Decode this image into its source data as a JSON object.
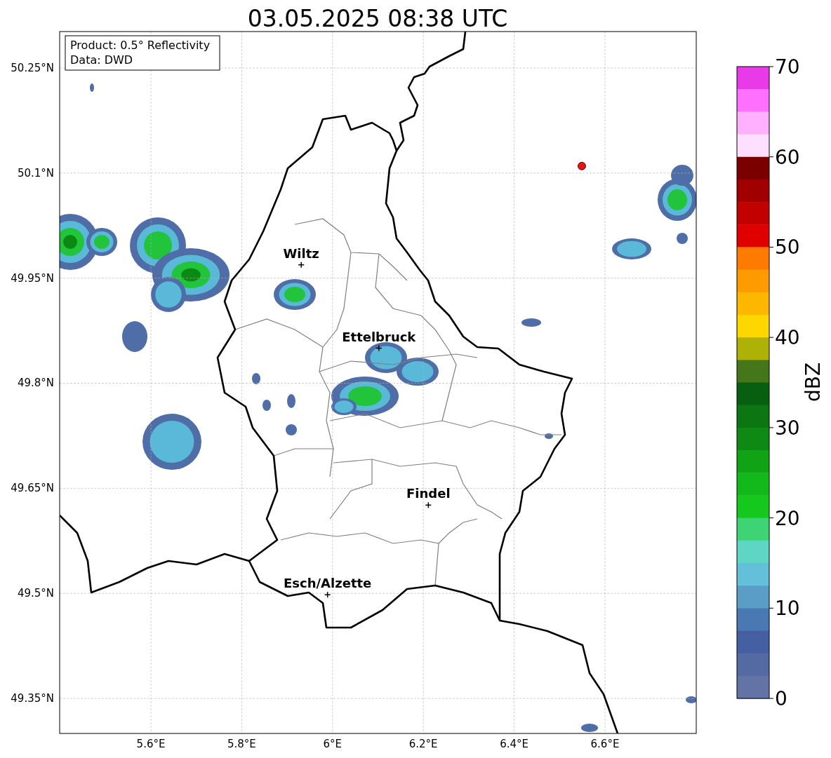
{
  "title": "03.05.2025 08:38 UTC",
  "info_box": [
    "Product: 0.5° Reflectivity",
    "Data: DWD"
  ],
  "map": {
    "x_ticks": [
      "5.6°E",
      "5.8°E",
      "6°E",
      "6.2°E",
      "6.4°E",
      "6.6°E"
    ],
    "y_ticks": [
      "50.25°N",
      "50.1°N",
      "49.95°N",
      "49.8°N",
      "49.65°N",
      "49.5°N",
      "49.35°N"
    ],
    "cities": [
      {
        "name": "Wiltz"
      },
      {
        "name": "Ettelbruck"
      },
      {
        "name": "Findel"
      },
      {
        "name": "Esch/Alzette"
      }
    ],
    "markers": [
      {
        "color": "#ee1111"
      }
    ]
  },
  "colorbar": {
    "label": "dBZ",
    "ticks": [
      "70",
      "60",
      "50",
      "40",
      "30",
      "20",
      "10",
      "0"
    ],
    "segments": [
      {
        "color": "#e83ae8"
      },
      {
        "color": "#ff70ff"
      },
      {
        "color": "#ffb0ff"
      },
      {
        "color": "#ffdfff"
      },
      {
        "color": "#7a0000"
      },
      {
        "color": "#a00000"
      },
      {
        "color": "#c20000"
      },
      {
        "color": "#e00000"
      },
      {
        "color": "#fd7c00"
      },
      {
        "color": "#fd9b00"
      },
      {
        "color": "#fdb700"
      },
      {
        "color": "#fed700"
      },
      {
        "color": "#afb206"
      },
      {
        "color": "#45761a"
      },
      {
        "color": "#085f10"
      },
      {
        "color": "#0b7612"
      },
      {
        "color": "#0e8a14"
      },
      {
        "color": "#10a315"
      },
      {
        "color": "#11b91b"
      },
      {
        "color": "#14c81e"
      },
      {
        "color": "#3ed374"
      },
      {
        "color": "#5fd6c5"
      },
      {
        "color": "#64bfdb"
      },
      {
        "color": "#5a9ec8"
      },
      {
        "color": "#4a78b3"
      },
      {
        "color": "#4460a2"
      },
      {
        "color": "#536aa3"
      },
      {
        "color": "#6473a6"
      }
    ]
  }
}
